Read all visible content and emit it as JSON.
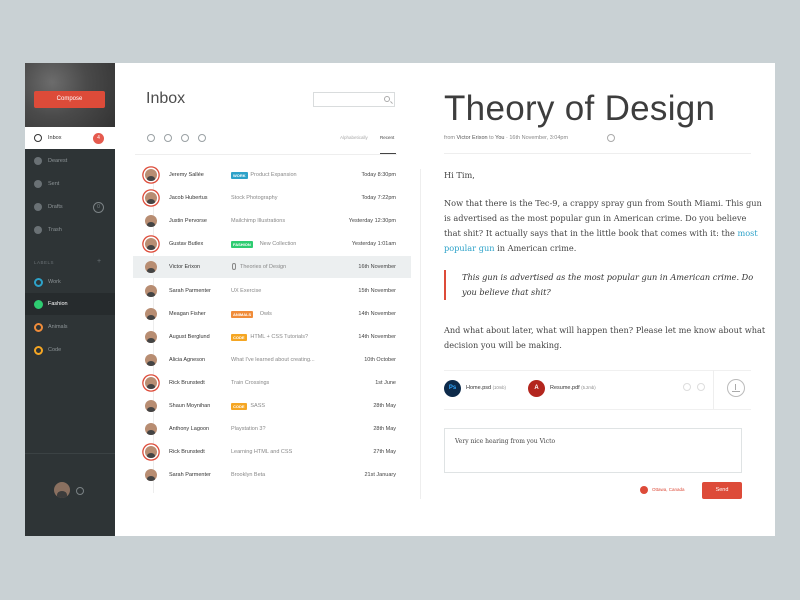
{
  "sidebar": {
    "compose_label": "Compose",
    "nav": [
      {
        "label": "Inbox",
        "count": "4",
        "icon": "inbox-icon"
      },
      {
        "label": "Dearest",
        "icon": "heart-icon"
      },
      {
        "label": "Sent",
        "icon": "sent-icon"
      },
      {
        "label": "Drafts",
        "count": "0",
        "icon": "drafts-icon"
      },
      {
        "label": "Trash",
        "icon": "trash-icon"
      }
    ],
    "labels_title": "LABELS",
    "labels_add": "+",
    "labels": [
      {
        "label": "Work",
        "color": "#2da2c9"
      },
      {
        "label": "Fashion",
        "color": "#2ecc71"
      },
      {
        "label": "Animals",
        "color": "#f08c3a"
      },
      {
        "label": "Code",
        "color": "#f5a623"
      }
    ]
  },
  "list": {
    "title": "Inbox",
    "search_placeholder": "",
    "sort_alphabetically": "Alphabetically",
    "sort_recent": "Recent",
    "toolbar_icons": [
      "refresh-icon",
      "archive-icon",
      "delete-icon",
      "more-icon"
    ],
    "rows": [
      {
        "name": "Jeremy Sallée",
        "tag": "WORK",
        "tag_color": "#2da2c9",
        "subject": "Product Expansion",
        "date": "Today 8:30pm",
        "ring": true
      },
      {
        "name": "Jacob Hubertus",
        "tag": "",
        "subject": "Stock Photography",
        "date": "Today 7:22pm",
        "ring": true
      },
      {
        "name": "Justin Pervorse",
        "tag": "",
        "subject": "Mailchimp Illustrations",
        "date": "Yesterday 12:30pm",
        "ring": false
      },
      {
        "name": "Gustav Butlex",
        "tag": "FASHION",
        "tag_color": "#2ecc71",
        "subject": "New Collection",
        "date": "Yesterday 1:01am",
        "ring": true
      },
      {
        "name": "Victor Erixon",
        "tag": "",
        "subject": "Theories of Design",
        "date": "16th November",
        "ring": false,
        "attachment": true,
        "active": true
      },
      {
        "name": "Sarah Parmenter",
        "tag": "",
        "subject": "UX Exercise",
        "date": "15th November",
        "ring": false
      },
      {
        "name": "Meagan Fisher",
        "tag": "ANIMALS",
        "tag_color": "#f08c3a",
        "subject": "Owls",
        "date": "14th November",
        "ring": false
      },
      {
        "name": "August Berglund",
        "tag": "CODE",
        "tag_color": "#f5a623",
        "subject": "HTML + CSS Tutorials?",
        "date": "14th November",
        "ring": false
      },
      {
        "name": "Alicia Agneson",
        "tag": "",
        "subject": "What I've learned about creating...",
        "date": "10th October",
        "ring": false
      },
      {
        "name": "Rick Brunstedt",
        "tag": "",
        "subject": "Train Crossings",
        "date": "1st June",
        "ring": true
      },
      {
        "name": "Shaun Moynihan",
        "tag": "CODE",
        "tag_color": "#f5a623",
        "subject": "SASS",
        "date": "28th May",
        "ring": false
      },
      {
        "name": "Anthony Lagoon",
        "tag": "",
        "subject": "Playstation 3?",
        "date": "28th May",
        "ring": false
      },
      {
        "name": "Rick Brunstedt",
        "tag": "",
        "subject": "Learning HTML and CSS",
        "date": "27th May",
        "ring": true
      },
      {
        "name": "Sarah Parmenter",
        "tag": "",
        "subject": "Brooklyn Beta",
        "date": "21st January",
        "ring": false
      }
    ]
  },
  "message": {
    "title": "Theory of Design",
    "meta_from": "from",
    "meta_sender": "Victor Erixon",
    "meta_to": "to",
    "meta_recipient": "You",
    "meta_sep": "·",
    "meta_date": "16th November, 3:04pm",
    "greeting": "Hi Tim,",
    "p1_before": "Now that there is the Tec-9, a crappy spray gun from South Miami. This gun is advertised as the most popular gun in American crime. Do you believe that shit? It actually says that in the little book that comes with it: the ",
    "p1_link": "most popular gun",
    "p1_after": " in American crime.",
    "quote": "This gun is advertised as the most popular gun in American crime. Do you believe that shit?",
    "p2": "And what about later, what will happen then? Please let me know about what decision you will be making.",
    "attachments": [
      {
        "icon_text": "Ps",
        "icon_color": "#0d2a4a",
        "name": "Home.psd",
        "size": "(10mb)"
      },
      {
        "icon_text": "A",
        "icon_color": "#b3261e",
        "name": "Resume.pdf",
        "size": "(5.2mb)"
      }
    ],
    "reply_text": "Very nice hearing from you Victo",
    "location": "Ottawa, Canada",
    "send_label": "Send"
  }
}
